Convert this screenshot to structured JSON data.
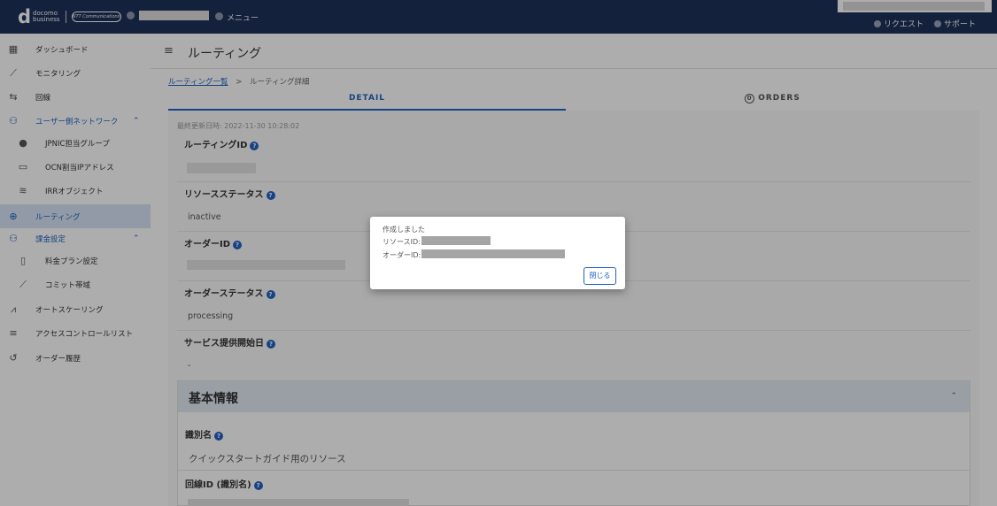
{
  "header": {
    "logo_mark": "d",
    "logo_line1": "docomo",
    "logo_line2": "business",
    "ntt_badge": "NTT Communications",
    "menu_label": "メニュー",
    "request_label": "リクエスト",
    "support_label": "サポート"
  },
  "sidebar": {
    "items": [
      {
        "label": "ダッシュボード",
        "icon": "dashboard-icon"
      },
      {
        "label": "モニタリング",
        "icon": "chart-line-icon"
      },
      {
        "label": "回線",
        "icon": "circuit-icon"
      },
      {
        "label": "ユーザー側ネットワーク",
        "icon": "network-icon"
      },
      {
        "label": "JPNIC担当グループ",
        "icon": "person-icon"
      },
      {
        "label": "OCN割当IPアドレス",
        "icon": "monitor-icon"
      },
      {
        "label": "IRRオブジェクト",
        "icon": "database-icon"
      },
      {
        "label": "ルーティング",
        "icon": "routing-icon"
      },
      {
        "label": "課金設定",
        "icon": "billing-icon"
      },
      {
        "label": "料金プラン設定",
        "icon": "plan-icon"
      },
      {
        "label": "コミット帯域",
        "icon": "commit-icon"
      },
      {
        "label": "オートスケーリング",
        "icon": "autoscale-icon"
      },
      {
        "label": "アクセスコントロールリスト",
        "icon": "acl-icon"
      },
      {
        "label": "オーダー履歴",
        "icon": "history-icon"
      }
    ]
  },
  "main": {
    "page_title": "ルーティング",
    "breadcrumb_link": "ルーティング一覧",
    "breadcrumb_sep": ">",
    "breadcrumb_current": "ルーティング詳細",
    "tab_detail": "DETAIL",
    "tab_orders_count": "0",
    "tab_orders": "ORDERS",
    "updated": "最終更新日時: 2022-11-30 10:28:02",
    "fields": {
      "routing_id_label": "ルーティングID",
      "resource_status_label": "リソースステータス",
      "resource_status_value": "inactive",
      "order_id_label": "オーダーID",
      "order_status_label": "オーダーステータス",
      "order_status_value": "processing",
      "service_start_label": "サービス提供開始日",
      "service_start_value": "-"
    },
    "section": {
      "title": "基本情報",
      "name_label": "識別名",
      "name_value": "クイックスタートガイド用のリソース",
      "circuit_label": "回線ID (識別名)"
    }
  },
  "dialog": {
    "title": "作成しました",
    "resource_id_label": "リソースID:",
    "order_id_label": "オーダーID:",
    "close_button": "閉じる"
  }
}
